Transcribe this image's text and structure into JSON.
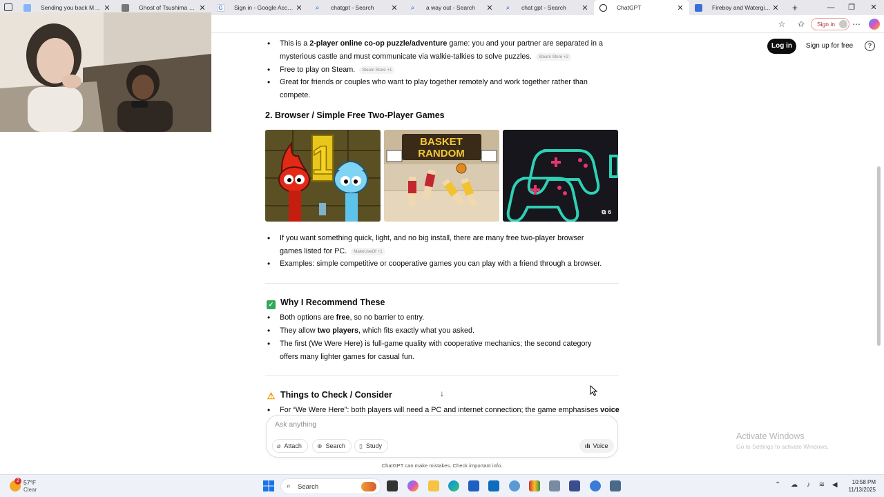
{
  "browser": {
    "tabs": [
      {
        "title": "Sending you back Meld to",
        "active": false
      },
      {
        "title": "Ghost of Tsushima DIRECTO",
        "active": false
      },
      {
        "title": "Sign in - Google Accounts",
        "active": false
      },
      {
        "title": "chatgpt - Search",
        "active": false
      },
      {
        "title": "a way out - Search",
        "active": false
      },
      {
        "title": "chat gpt - Search",
        "active": false
      },
      {
        "title": "ChatGPT",
        "active": true
      },
      {
        "title": "Fireboy and Watergirl - Pla",
        "active": false
      }
    ],
    "signin_label": "Sign in"
  },
  "auth": {
    "login_label": "Log in",
    "signup_label": "Sign up for free",
    "help_label": "?"
  },
  "content": {
    "top_bullets": [
      {
        "pre": "This is a ",
        "bold": "2-player online co-op puzzle/adventure",
        "post": " game: you and your partner are separated in a mysterious castle and must communicate via walkie-talkies to solve puzzles.",
        "cite": "Steam Store +2"
      },
      {
        "pre": "Free to play on Steam.",
        "bold": "",
        "post": "",
        "cite": "Steam Store +1"
      },
      {
        "pre": "Great for friends or couples who want to play together remotely and work together rather than compete.",
        "bold": "",
        "post": "",
        "cite": ""
      }
    ],
    "section2_heading": "2. Browser / Simple Free Two-Player Games",
    "image_count": "6",
    "thumb_text": {
      "basket": "BASKET",
      "random": "RANDOM",
      "one": "1"
    },
    "mid_bullets": [
      {
        "text": "If you want something quick, light, and no big install, there are many free two-player browser games listed for PC.",
        "cite": "MakeUseOf +1"
      },
      {
        "text": "Examples: simple competitive or cooperative games you can play with a friend through a browser.",
        "cite": ""
      }
    ],
    "why_heading": "Why I Recommend These",
    "why_bullets": [
      {
        "pre": "Both options are ",
        "bold": "free",
        "post": ", so no barrier to entry."
      },
      {
        "pre": "They allow ",
        "bold": "two players",
        "post": ", which fits exactly what you asked."
      },
      {
        "pre": "The first (We Were Here) is full-game quality with cooperative mechanics; the second category offers many lighter games for casual fun.",
        "bold": "",
        "post": ""
      }
    ],
    "check_heading": "Things to Check / Consider",
    "check_bullet_pre": "For “We Were Here”: both players will need a PC and internet connection; the game emphasises ",
    "check_bullet_bold": "voice"
  },
  "composer": {
    "placeholder": "Ask anything",
    "attach_label": "Attach",
    "search_label": "Search",
    "study_label": "Study",
    "voice_label": "Voice"
  },
  "disclaimer": "ChatGPT can make mistakes. Check important info.",
  "watermark": {
    "title": "Activate Windows",
    "subtitle": "Go to Settings to activate Windows."
  },
  "taskbar": {
    "weather_temp": "57°F",
    "weather_cond": "Clear",
    "weather_badge": "2",
    "search_label": "Search",
    "time": "10:58 PM",
    "date": "11/13/2025"
  },
  "colors": {
    "accent_black": "#0d0d0d",
    "check_green": "#34a853",
    "warning_orange": "#f29900"
  }
}
